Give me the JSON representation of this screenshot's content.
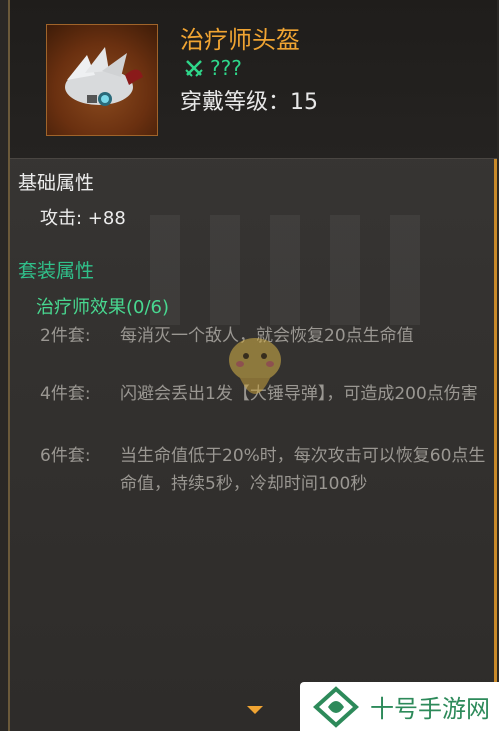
{
  "item": {
    "name": "治疗师头盔",
    "rarity": "???",
    "wear_level": "穿戴等级：15"
  },
  "base_section": {
    "title": "基础属性",
    "attack": "攻击: +88"
  },
  "set_section": {
    "title": "套装属性",
    "set_name": "治疗师效果(0/6)",
    "bonuses": [
      {
        "label": "2件套:",
        "text": "每消灭一个敌人，就会恢复20点生命值"
      },
      {
        "label": "4件套:",
        "text": "闪避会丢出1发【大锤导弹】，可造成200点伤害"
      },
      {
        "label": "6件套:",
        "text": "当生命值低于20%时，每次攻击可以恢复60点生命值，持续5秒，冷却时间100秒"
      }
    ]
  },
  "watermark": {
    "text": "十号手游网"
  },
  "colors": {
    "title": "#f0a432",
    "rarity": "#2fd68a",
    "set": "#30c08a",
    "accent_border": "#c98a2a"
  }
}
